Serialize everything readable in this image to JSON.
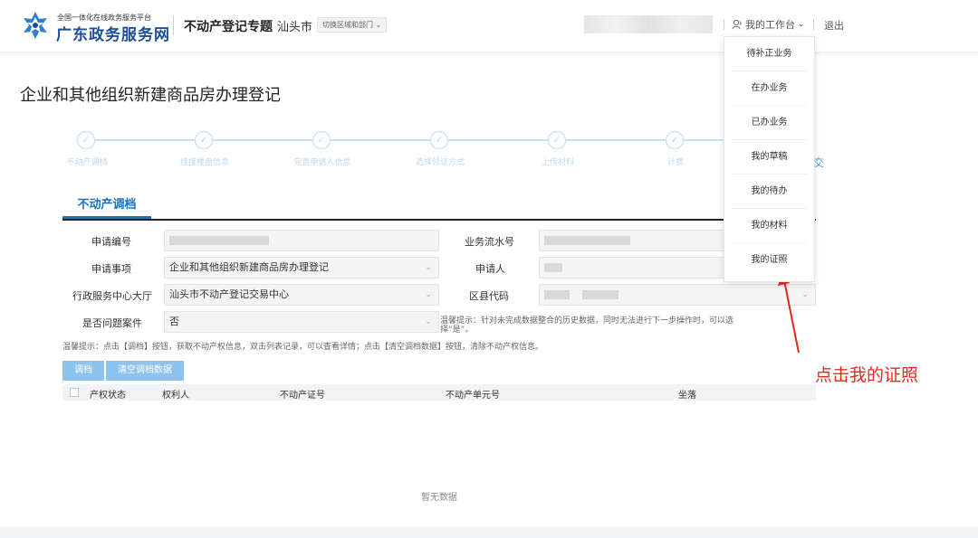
{
  "header": {
    "platform_small": "全国一体化在线政务服务平台",
    "platform_big": "广东政务服务网",
    "topic": "不动产登记专题",
    "city": "汕头市",
    "region_switch": "切换区域和部门",
    "workbench": "我的工作台",
    "logout": "退出"
  },
  "dropdown": {
    "items": [
      "待补正业务",
      "在办业务",
      "已办业务",
      "我的草稿",
      "我的待办",
      "我的材料",
      "我的证照"
    ]
  },
  "page": {
    "title": "企业和其他组织新建商品房办理登记"
  },
  "steps": {
    "labels": [
      "不动产调档",
      "挂接楼盘信息",
      "完善申请人信息",
      "选择领证方式",
      "上传材料",
      "计费"
    ],
    "last_label": "交"
  },
  "tab": {
    "label": "不动产调档"
  },
  "form": {
    "apply_no_label": "申请编号",
    "serial_label": "业务流水号",
    "matter_label": "申请事项",
    "matter_value": "企业和其他组织新建商品房办理登记",
    "applicant_label": "申请人",
    "hall_label": "行政服务中心大厅",
    "hall_value": "汕头市不动产登记交易中心",
    "district_label": "区县代码",
    "problem_label": "是否问题案件",
    "problem_value": "否"
  },
  "hints": {
    "right_hint": "温馨提示：针对未完成数据整合的历史数据，同时无法进行下一步操作时，可以选择“是”。",
    "bottom_hint": "温馨提示：点击【调档】按钮，获取不动产权信息，双击列表记录，可以查看详情；点击【清空调档数据】按钮，清除不动产权信息。"
  },
  "buttons": {
    "fetch": "调档",
    "clear": "清空调档数据"
  },
  "table": {
    "headers": [
      "产权状态",
      "权利人",
      "不动产证号",
      "不动产单元号",
      "坐落"
    ],
    "empty": "暂无数据"
  },
  "annotation": {
    "text": "点击我的证照",
    "color": "#e42a1f"
  },
  "colors": {
    "brand": "#1c4e9c",
    "accent": "#1c6fc1",
    "button": "#8ec3ee"
  }
}
